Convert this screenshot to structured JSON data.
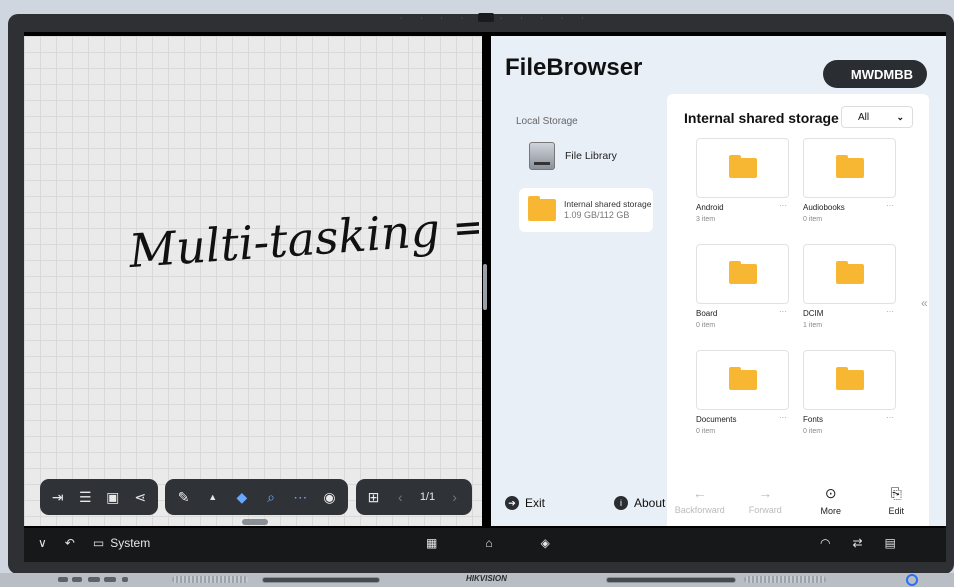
{
  "device": {
    "brand": "HIKVISION"
  },
  "whiteboard": {
    "handwriting": "Multi-tasking ⇒",
    "toolbar": {
      "page_indicator": "1/1"
    }
  },
  "filebrowser": {
    "title": "FileBrowser",
    "user": "MWDMBB",
    "local_storage_label": "Local Storage",
    "file_library_label": "File Library",
    "storage": {
      "name": "Internal shared storage",
      "size": "1.09 GB/112 GB"
    },
    "exit_label": "Exit",
    "about_label": "About",
    "panel_title": "Internal shared storage",
    "filter": {
      "selected": "All"
    },
    "folders": [
      {
        "name": "Android",
        "count": "3 item"
      },
      {
        "name": "Audiobooks",
        "count": "0 item"
      },
      {
        "name": "Board",
        "count": "0 item"
      },
      {
        "name": "DCIM",
        "count": "1 item"
      },
      {
        "name": "Documents",
        "count": "0 item"
      },
      {
        "name": "Fonts",
        "count": "0 item"
      }
    ],
    "bottom_actions": {
      "back": "Backforward",
      "forward": "Forward",
      "more": "More",
      "edit": "Edit"
    }
  },
  "taskbar": {
    "system_label": "System"
  },
  "colors": {
    "accent": "#f7b733",
    "dark": "#2a2d31",
    "power": "#2d6ef5"
  }
}
